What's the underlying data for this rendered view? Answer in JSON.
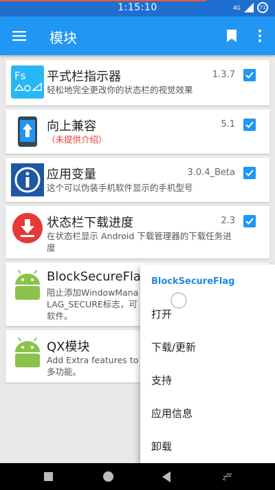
{
  "status_bar": {
    "time": "1:15:10",
    "network": "4G",
    "battery": "71"
  },
  "app_bar": {
    "title": "模块"
  },
  "modules": [
    {
      "name": "平式栏指示器",
      "version": "1.3.7",
      "desc": "轻松地完全更改你的状态栏的视觉效果",
      "icon": "fs-indicator-icon",
      "checked": true
    },
    {
      "name": "向上兼容",
      "version": "5.1",
      "desc": "（未提供介绍）",
      "icon": "upward-arrow-phone-icon",
      "checked": true
    },
    {
      "name": "应用变量",
      "version": "3.0.4_Beta",
      "desc": "这个可以伪装手机软件显示的手机型号",
      "icon": "info-icon",
      "checked": true
    },
    {
      "name": "状态栏下载进度",
      "version": "2.3",
      "desc": "在状态栏显示 Android 下载管理器的下载任务进度",
      "icon": "download-icon",
      "checked": true
    },
    {
      "name": "BlockSecureFlag",
      "desc": "阻止添加WindowMana\nLAG_SECURE标志，可\n软件。",
      "icon": "android-icon"
    },
    {
      "name": "QX模块",
      "desc": "Add Extra features to \n多功能。",
      "icon": "android-icon"
    }
  ],
  "popup": {
    "title": "BlockSecureFlag",
    "items": [
      "打开",
      "下载/更新",
      "支持",
      "应用信息",
      "卸载"
    ]
  },
  "colors": {
    "primary": "#2196f3",
    "status_bar": "#1f6fd1",
    "accent_red": "#e53935"
  }
}
